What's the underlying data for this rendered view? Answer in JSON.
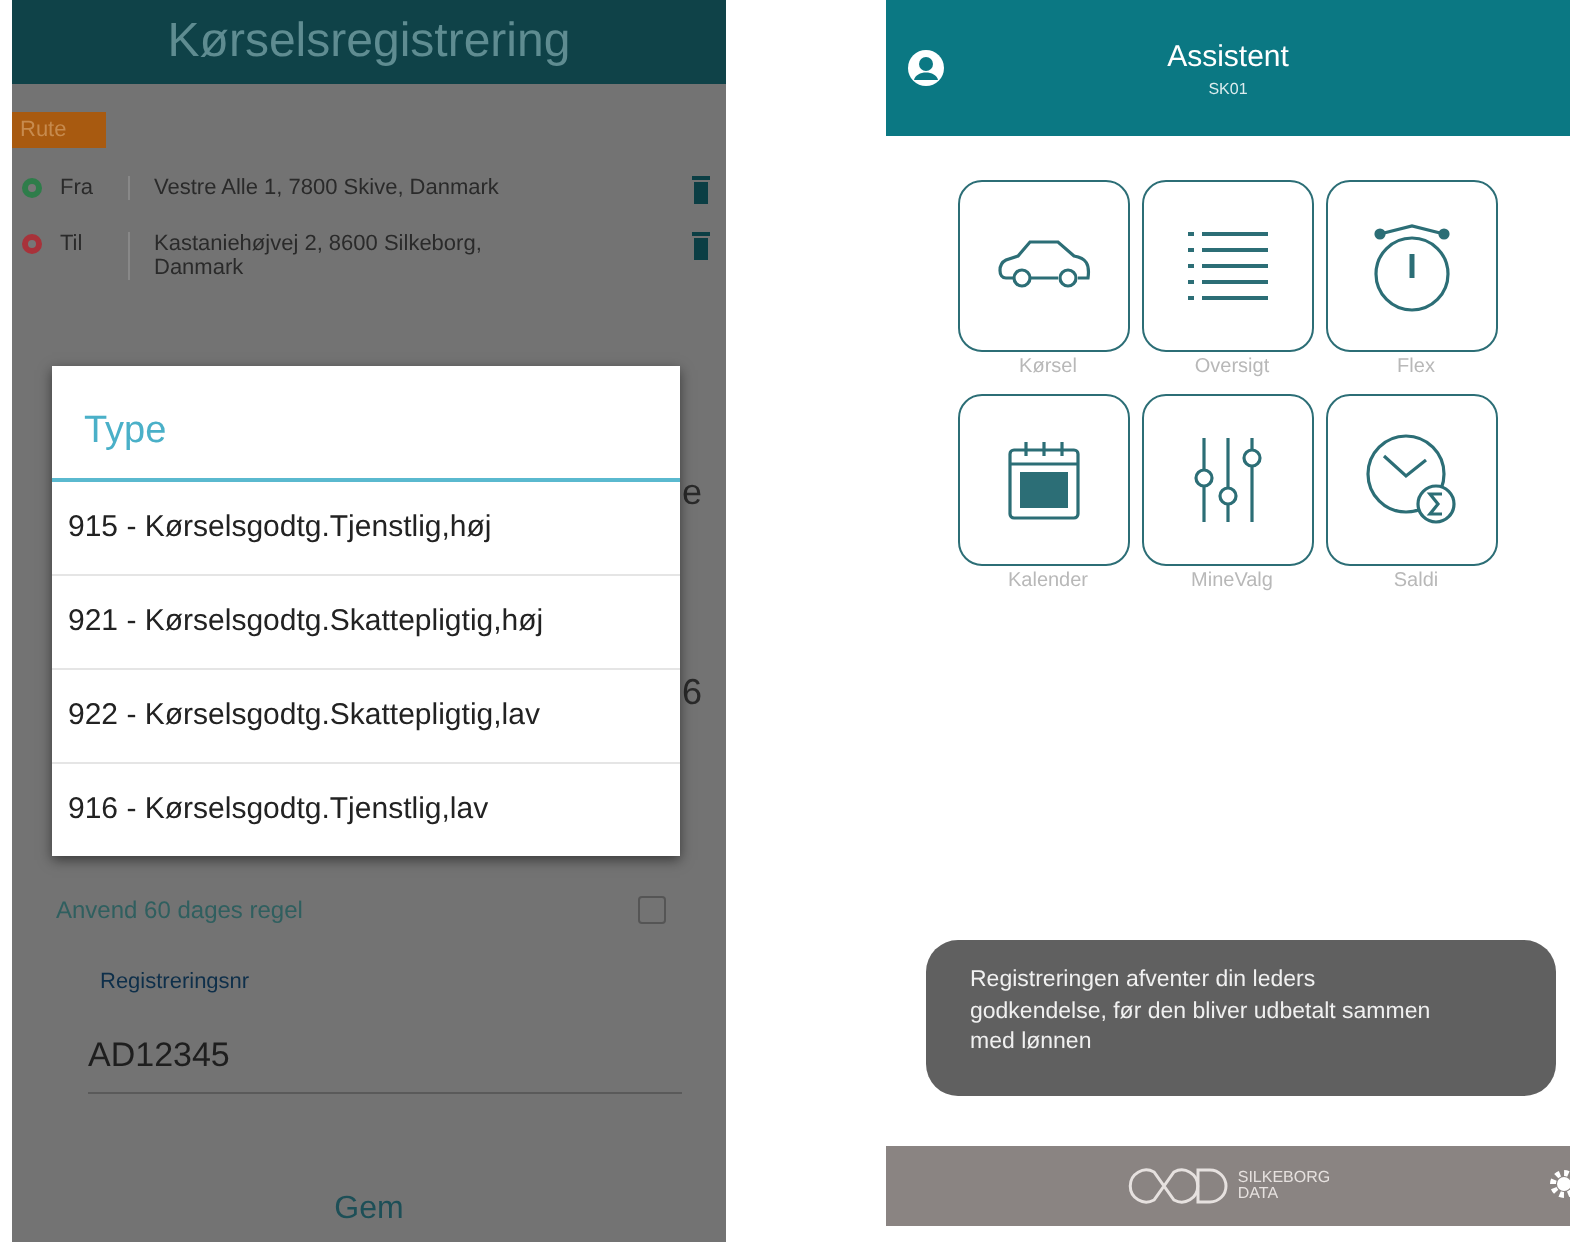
{
  "left_screen": {
    "title": "Kørselsregistrering",
    "route_tag": "Rute",
    "stops": [
      {
        "kind": "from",
        "label": "Fra",
        "address": "Vestre Alle 1, 7800 Skive, Danmark"
      },
      {
        "kind": "to",
        "label": "Til",
        "address": "Kastaniehøjvej 2, 8600 Silkeborg, Danmark"
      }
    ],
    "partial_texts": [
      "e",
      "6"
    ],
    "checkbox": {
      "label": "Anvend 60 dages regel",
      "checked": false
    },
    "registration": {
      "label": "Registreringsnr",
      "value": "AD12345"
    },
    "save_button": "Gem",
    "dialog": {
      "title": "Type",
      "options": [
        {
          "label": "915 - Kørselsgodtg.Tjenstlig,høj"
        },
        {
          "label": "921 - Kørselsgodtg.Skattepligtig,høj"
        },
        {
          "label": "922 - Kørselsgodtg.Skattepligtig,lav"
        },
        {
          "label": "916 - Kørselsgodtg.Tjenstlig,lav"
        }
      ]
    }
  },
  "right_screen": {
    "title": "Assistent",
    "subtitle": "SK01",
    "tiles": [
      {
        "kind": "car",
        "label": "Kørsel"
      },
      {
        "kind": "list",
        "label": "Oversigt"
      },
      {
        "kind": "stopwatch",
        "label": "Flex"
      },
      {
        "kind": "calendar",
        "label": "Kalender"
      },
      {
        "kind": "sliders",
        "label": "MineValg"
      },
      {
        "kind": "clock-sum",
        "label": "Saldi"
      }
    ],
    "toast": "Registreringen afventer din leders godkendelse, før den bliver udbetalt sammen med lønnen",
    "footer": {
      "logo_line1": "SILKEBORG",
      "logo_line2": "DATA"
    }
  }
}
